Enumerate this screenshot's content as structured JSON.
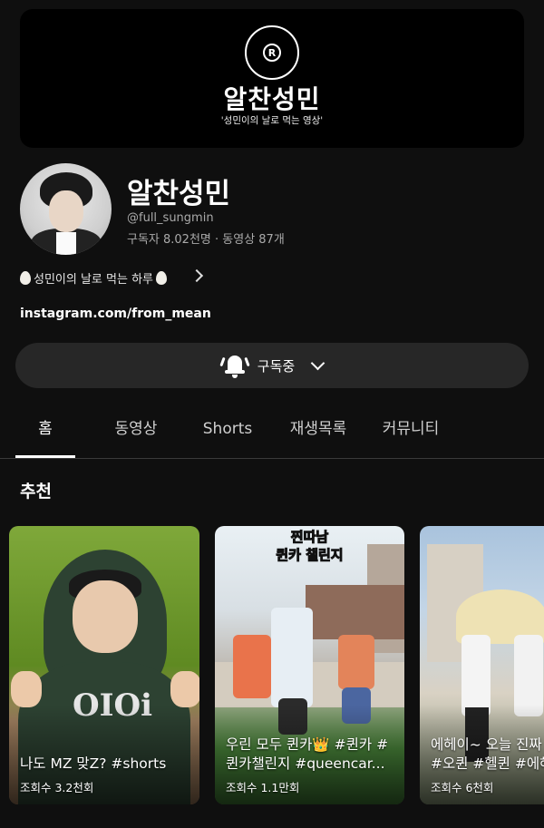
{
  "banner": {
    "logo_letter": "R",
    "title": "알찬성민",
    "subtitle": "'성민이의 날로 먹는 영상'"
  },
  "channel": {
    "name": "알찬성민",
    "handle": "@full_sungmin",
    "stats": "구독자 8.02천명 · 동영상 87개",
    "description": "성민이의 날로 먹는 하루",
    "link": "instagram.com/from_mean"
  },
  "subscribe": {
    "label": "구독중",
    "icon": "bell-icon"
  },
  "tabs": [
    {
      "label": "홈",
      "active": true
    },
    {
      "label": "동영상",
      "active": false
    },
    {
      "label": "Shorts",
      "active": false
    },
    {
      "label": "재생목록",
      "active": false
    },
    {
      "label": "커뮤니티",
      "active": false
    }
  ],
  "section": {
    "title": "추천"
  },
  "cards": [
    {
      "title": "나도 MZ 맞Z? #shorts",
      "views": "조회수 3.2천회",
      "shirt_text": "OIOi"
    },
    {
      "title": "우린 모두 퀸카👑 #퀸카 #\n퀸카챌린지 #queencar...",
      "views": "조회수 1.1만회",
      "overlay_text": "찐따남\n퀸카 챌린지"
    },
    {
      "title": "에헤이~ 오늘 진짜\n#오퀸 #헬퀸 #에헤",
      "views": "조회수 6천회"
    }
  ]
}
